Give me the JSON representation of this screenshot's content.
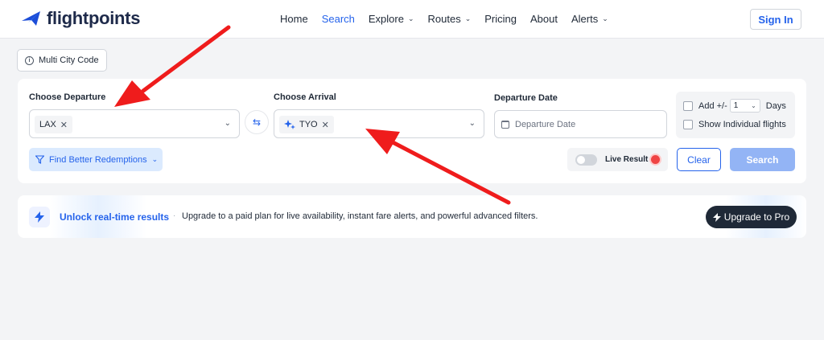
{
  "brand": {
    "name": "flightpoints",
    "color": "#1d4ed8"
  },
  "nav": {
    "links": [
      {
        "label": "Home",
        "active": false,
        "dropdown": false
      },
      {
        "label": "Search",
        "active": true,
        "dropdown": false
      },
      {
        "label": "Explore",
        "active": false,
        "dropdown": true
      },
      {
        "label": "Routes",
        "active": false,
        "dropdown": true
      },
      {
        "label": "Pricing",
        "active": false,
        "dropdown": false
      },
      {
        "label": "About",
        "active": false,
        "dropdown": false
      },
      {
        "label": "Alerts",
        "active": false,
        "dropdown": true
      }
    ],
    "signin_label": "Sign In"
  },
  "multi_city": {
    "label": "Multi City Code",
    "icon": "info-icon"
  },
  "search": {
    "departure": {
      "label": "Choose Departure",
      "selected": "LAX"
    },
    "arrival": {
      "label": "Choose Arrival",
      "selected": "TYO",
      "icon": "sparkle-icon"
    },
    "date": {
      "label": "Departure Date",
      "placeholder": "Departure Date"
    },
    "options": {
      "flex_label": "Add +/-",
      "flex_value": "1",
      "flex_unit": "Days",
      "individual_label": "Show Individual flights"
    },
    "better_label": "Find Better Redemptions",
    "live_label": "Live Result",
    "clear_label": "Clear",
    "search_label": "Search"
  },
  "banner": {
    "title": "Unlock real-time results",
    "separator": "·",
    "description": "Upgrade to a paid plan for live availability, instant fare alerts, and powerful advanced filters.",
    "cta": "Upgrade to Pro"
  },
  "colors": {
    "accent": "#2563eb",
    "annotation_arrow": "#ef1c1c",
    "live_dot": "#ef4444",
    "search_button": "#93b4f5"
  }
}
